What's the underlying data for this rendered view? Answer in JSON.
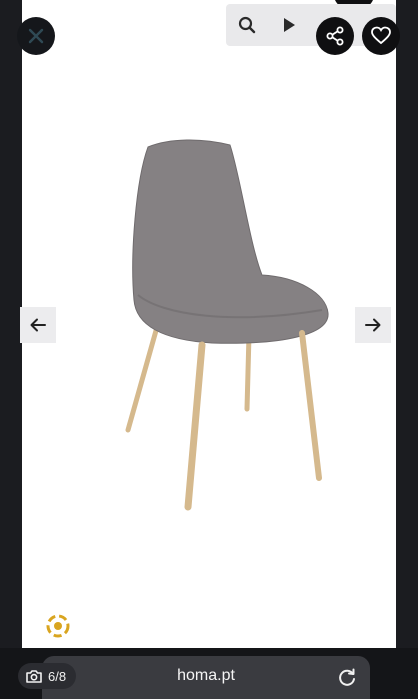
{
  "icons": {
    "close": "close-icon",
    "search": "search-icon",
    "play": "play-icon",
    "share": "share-icon",
    "favorite": "heart-icon",
    "prev": "arrow-left-icon",
    "next": "arrow-right-icon",
    "camera": "camera-icon",
    "reload": "reload-icon",
    "badge": "loading-badge-icon"
  },
  "gallery": {
    "counter": "6/8"
  },
  "browser": {
    "url": "homa.pt"
  },
  "colors": {
    "background": "#1b1c20",
    "chair_fabric": "#858183",
    "chair_legs": "#d5b98d",
    "toolbar": "#e9e9eb",
    "badge": "#d9a520"
  }
}
